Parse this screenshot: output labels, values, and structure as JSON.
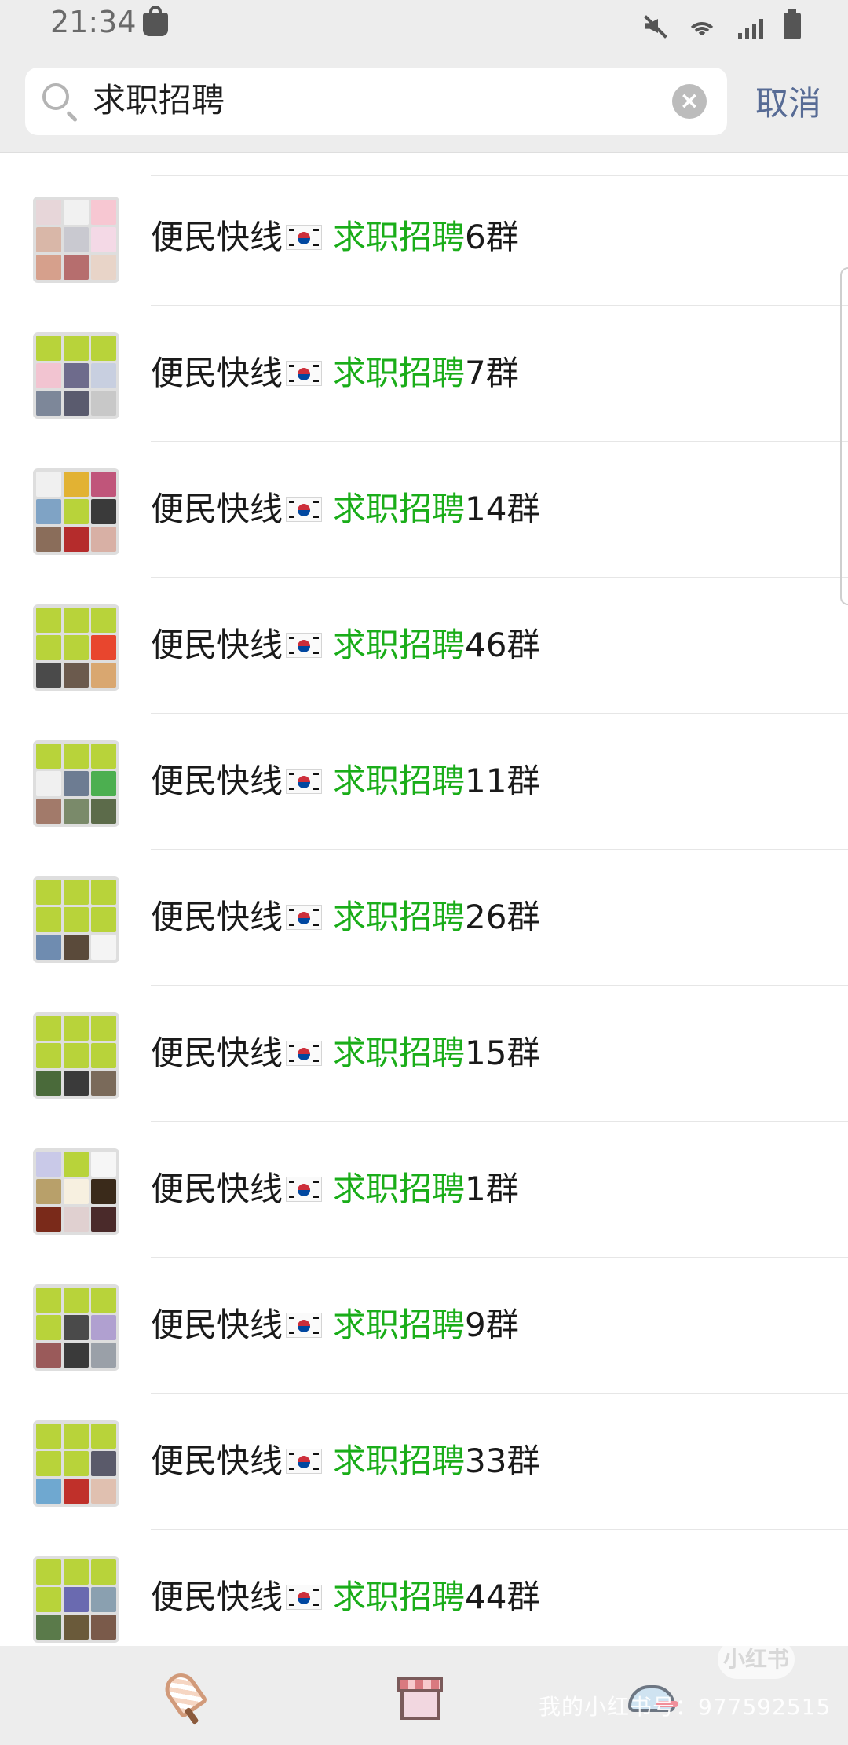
{
  "status_bar": {
    "time": "21:34",
    "icons": [
      "shopping-bag-icon",
      "mute-icon",
      "wifi-icon",
      "signal-icon",
      "battery-icon"
    ]
  },
  "search": {
    "query": "求职招聘",
    "cancel_label": "取消",
    "clear_icon": "close-icon"
  },
  "results": [
    {
      "prefix": "便民快线",
      "flag": "south-korea-flag-icon",
      "highlight": "求职招聘",
      "suffix": "6群"
    },
    {
      "prefix": "便民快线",
      "flag": "south-korea-flag-icon",
      "highlight": "求职招聘",
      "suffix": "7群"
    },
    {
      "prefix": "便民快线",
      "flag": "south-korea-flag-icon",
      "highlight": "求职招聘",
      "suffix": "14群"
    },
    {
      "prefix": "便民快线",
      "flag": "south-korea-flag-icon",
      "highlight": "求职招聘",
      "suffix": "46群"
    },
    {
      "prefix": "便民快线",
      "flag": "south-korea-flag-icon",
      "highlight": "求职招聘",
      "suffix": "11群"
    },
    {
      "prefix": "便民快线",
      "flag": "south-korea-flag-icon",
      "highlight": "求职招聘",
      "suffix": "26群"
    },
    {
      "prefix": "便民快线",
      "flag": "south-korea-flag-icon",
      "highlight": "求职招聘",
      "suffix": "15群"
    },
    {
      "prefix": "便民快线",
      "flag": "south-korea-flag-icon",
      "highlight": "求职招聘",
      "suffix": "1群"
    },
    {
      "prefix": "便民快线",
      "flag": "south-korea-flag-icon",
      "highlight": "求职招聘",
      "suffix": "9群"
    },
    {
      "prefix": "便民快线",
      "flag": "south-korea-flag-icon",
      "highlight": "求职招聘",
      "suffix": "33群"
    },
    {
      "prefix": "便民快线",
      "flag": "south-korea-flag-icon",
      "highlight": "求职招聘",
      "suffix": "44群"
    }
  ],
  "colors": {
    "highlight": "#1aad19",
    "cancel": "#576b95",
    "header_bg": "#ededed"
  },
  "bottom_bar": {
    "icons": [
      "ice-cream-icon",
      "shop-icon",
      "hat-icon"
    ]
  },
  "watermark": {
    "badge": "小红书",
    "text": "我的小红书号：977592515"
  }
}
